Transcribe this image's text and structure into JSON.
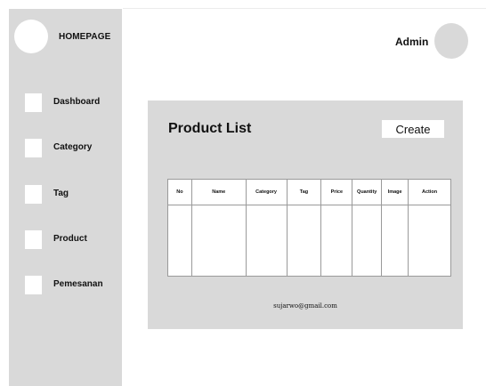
{
  "sidebar": {
    "brand": "HOMEPAGE",
    "items": [
      {
        "label": "Dashboard"
      },
      {
        "label": "Category"
      },
      {
        "label": "Tag"
      },
      {
        "label": "Product"
      },
      {
        "label": "Pemesanan"
      }
    ]
  },
  "header": {
    "user": "Admin"
  },
  "main": {
    "title": "Product List",
    "create_label": "Create",
    "table": {
      "columns": [
        "No",
        "Name",
        "Category",
        "Tag",
        "Price",
        "Quantity",
        "Image",
        "Action"
      ],
      "rows": []
    },
    "footer_email": "sujarwo@gmail.com"
  }
}
